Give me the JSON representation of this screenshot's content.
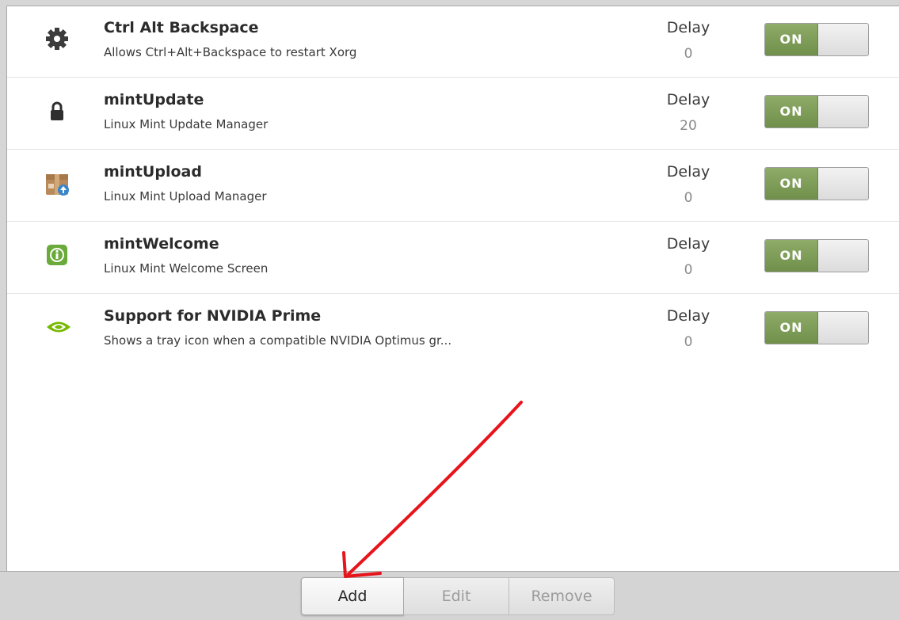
{
  "startup_apps": [
    {
      "name": "Ctrl Alt Backspace",
      "description": "Allows Ctrl+Alt+Backspace to restart Xorg",
      "delay_label": "Delay",
      "delay": "0",
      "toggle": "ON",
      "icon": "gear-icon"
    },
    {
      "name": "mintUpdate",
      "description": "Linux Mint Update Manager",
      "delay_label": "Delay",
      "delay": "20",
      "toggle": "ON",
      "icon": "lock-icon"
    },
    {
      "name": "mintUpload",
      "description": "Linux Mint Upload Manager",
      "delay_label": "Delay",
      "delay": "0",
      "toggle": "ON",
      "icon": "upload-box-icon"
    },
    {
      "name": "mintWelcome",
      "description": "Linux Mint Welcome Screen",
      "delay_label": "Delay",
      "delay": "0",
      "toggle": "ON",
      "icon": "info-icon"
    },
    {
      "name": "Support for NVIDIA Prime",
      "description": "Shows a tray icon when a compatible NVIDIA Optimus gr...",
      "delay_label": "Delay",
      "delay": "0",
      "toggle": "ON",
      "icon": "nvidia-icon"
    }
  ],
  "toolbar": {
    "add": "Add",
    "edit": "Edit",
    "remove": "Remove"
  },
  "colors": {
    "toggle_on": "#7d9c58",
    "annotation_arrow": "#e8141b"
  }
}
